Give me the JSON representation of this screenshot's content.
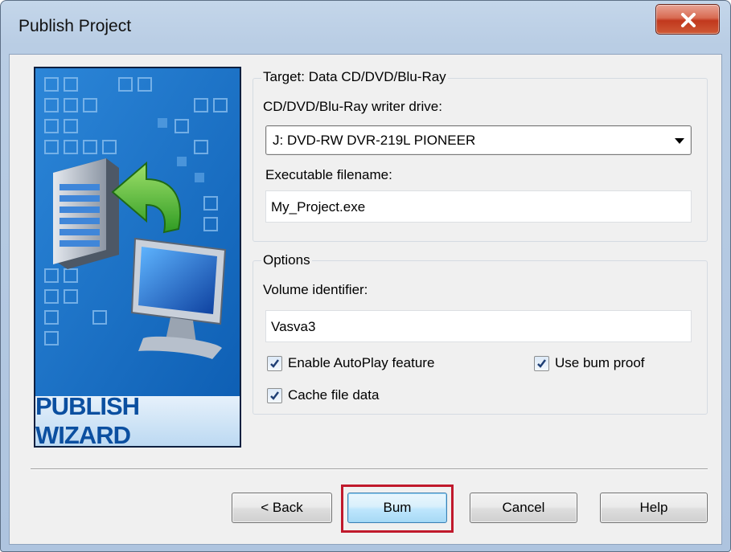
{
  "window": {
    "title": "Publish Project",
    "close_icon": "close-icon"
  },
  "banner": {
    "caption": "PUBLISH WIZARD",
    "illustration_icons": [
      "server-icon",
      "arrow-icon",
      "monitor-icon"
    ]
  },
  "target": {
    "group_label": "Target: Data CD/DVD/Blu-Ray",
    "drive_label": "CD/DVD/Blu-Ray writer drive:",
    "drive_value": "J: DVD-RW  DVR-219L PIONEER",
    "filename_label": "Executable filename:",
    "filename_value": "My_Project.exe"
  },
  "options": {
    "group_label": "Options",
    "volume_label": "Volume identifier:",
    "volume_value": "Vasva3",
    "autoplay_label": "Enable AutoPlay feature",
    "autoplay_checked": true,
    "burnproof_label": "Use bum proof",
    "burnproof_checked": true,
    "cache_label": "Cache file data",
    "cache_checked": true
  },
  "buttons": {
    "back": "< Back",
    "burn": "Bum",
    "cancel": "Cancel",
    "help": "Help"
  },
  "colors": {
    "highlight": "#c0192c",
    "close_button": "#c1381d",
    "banner_blue": "#1a73c8"
  }
}
